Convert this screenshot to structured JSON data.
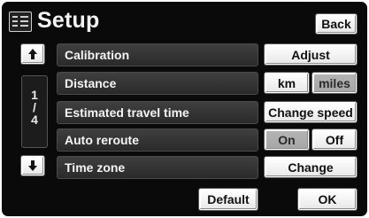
{
  "header": {
    "title": "Setup",
    "menu_icon": "list-menu-icon",
    "back_label": "Back"
  },
  "scroll": {
    "up_icon": "arrow-up-icon",
    "down_icon": "arrow-down-icon",
    "page_current": "1",
    "page_sep": "/",
    "page_total": "4"
  },
  "rows": [
    {
      "label": "Calibration",
      "buttons": [
        "Adjust"
      ]
    },
    {
      "label": "Distance",
      "buttons": [
        "km",
        "miles"
      ],
      "selected": "km"
    },
    {
      "label": "Estimated travel time",
      "buttons": [
        "Change speed"
      ]
    },
    {
      "label": "Auto reroute",
      "buttons": [
        "On",
        "Off"
      ],
      "selected": "Off"
    },
    {
      "label": "Time zone",
      "buttons": [
        "Change"
      ]
    }
  ],
  "footer": {
    "default_label": "Default",
    "ok_label": "OK"
  }
}
